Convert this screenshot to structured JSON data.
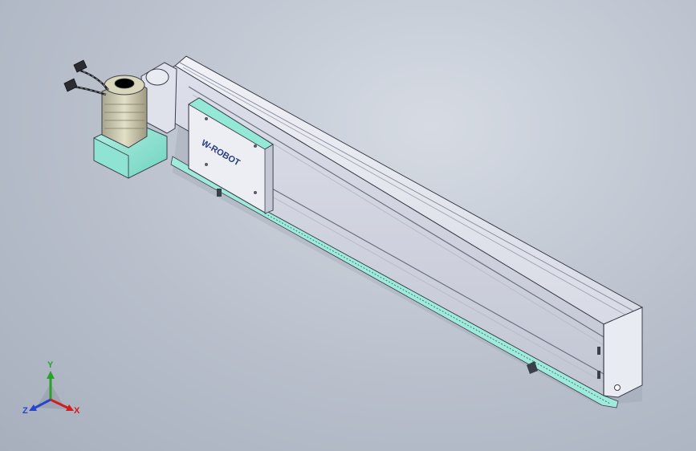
{
  "scene": {
    "background_top": "#d6dbe3",
    "background_bottom": "#a7afbd",
    "module_brand_text": "W-ROBOT",
    "colors": {
      "body": "#e4e6ee",
      "body_shade": "#c9ccd8",
      "body_dark": "#9ea3b2",
      "accent_teal": "#8fe3d2",
      "edge": "#3b3f4a",
      "brand": "#2a3f7a"
    }
  },
  "triad": {
    "x_label": "X",
    "y_label": "Y",
    "z_label": "Z",
    "x_color": "#d11f1f",
    "y_color": "#2aa12a",
    "z_color": "#2a46c8"
  }
}
